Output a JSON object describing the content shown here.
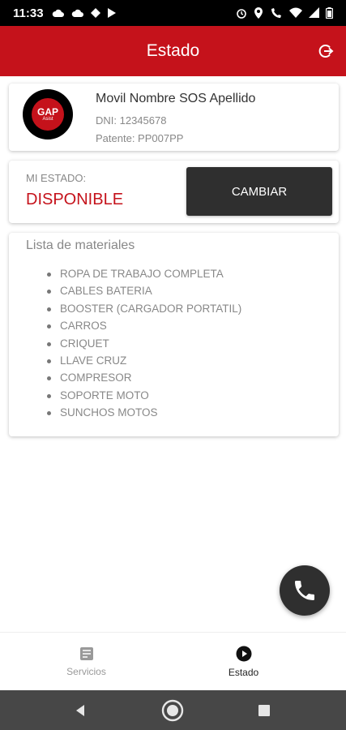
{
  "status_bar": {
    "time": "11:33",
    "left_icons": [
      "cloud-icon",
      "cloud-icon",
      "diamond-icon",
      "play-icon"
    ],
    "right_icons": [
      "alarm-icon",
      "location-icon",
      "wifi-call-icon",
      "wifi-icon",
      "signal-icon",
      "battery-icon"
    ]
  },
  "app_bar": {
    "title": "Estado",
    "logout_icon": "logout-icon"
  },
  "profile": {
    "avatar_text": "GAP",
    "avatar_sub": "Asist",
    "name": "Movil Nombre SOS Apellido",
    "dni": "DNI: 12345678",
    "patente": "Patente: PP007PP"
  },
  "state": {
    "label": "MI ESTADO:",
    "value": "DISPONIBLE",
    "button_label": "CAMBIAR"
  },
  "materials": {
    "title": "Lista de materiales",
    "items": [
      "ROPA DE TRABAJO COMPLETA",
      "CABLES BATERIA",
      "BOOSTER (CARGADOR PORTATIL)",
      "CARROS",
      "CRIQUET",
      "LLAVE CRUZ",
      "COMPRESOR",
      "SOPORTE MOTO",
      "SUNCHOS MOTOS"
    ]
  },
  "fab": {
    "icon": "phone-icon"
  },
  "bottom_nav": {
    "items": [
      {
        "label": "Servicios",
        "icon": "document-icon",
        "active": false
      },
      {
        "label": "Estado",
        "icon": "play-circle-icon",
        "active": true
      }
    ]
  },
  "colors": {
    "brand": "#c5121b",
    "dark_button": "#2f2f2f",
    "muted_text": "#888888"
  }
}
